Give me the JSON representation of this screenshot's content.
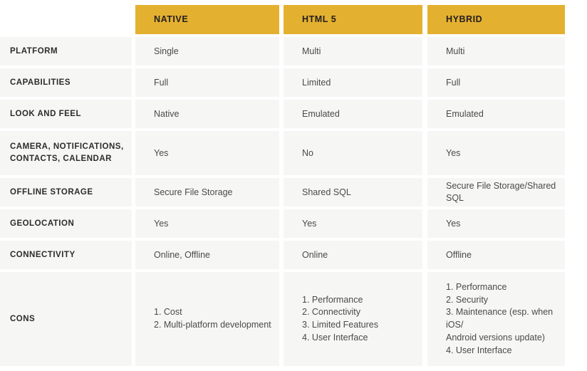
{
  "table": {
    "accent_color": "#e4b030",
    "cell_background": "#f6f6f5",
    "page_background": "#ffffff",
    "label_color": "#2c2c2c",
    "value_color": "#4a4a4a",
    "corner_label": "",
    "columns": [
      "NATIVE",
      "HTML 5",
      "HYBRID"
    ],
    "rows": [
      {
        "label": "PLATFORM",
        "values": [
          "Single",
          "Multi",
          "Multi"
        ]
      },
      {
        "label": "CAPABILITIES",
        "values": [
          "Full",
          "Limited",
          "Full"
        ]
      },
      {
        "label": "LOOK AND FEEL",
        "values": [
          "Native",
          "Emulated",
          "Emulated"
        ]
      },
      {
        "label": "CAMERA, NOTIFICATIONS, CONTACTS, CALENDAR",
        "values": [
          "Yes",
          "No",
          "Yes"
        ]
      },
      {
        "label": "OFFLINE STORAGE",
        "values": [
          "Secure File Storage",
          "Shared SQL",
          "Secure File Storage/Shared SQL"
        ]
      },
      {
        "label": "GEOLOCATION",
        "values": [
          "Yes",
          "Yes",
          "Yes"
        ]
      },
      {
        "label": "CONNECTIVITY",
        "values": [
          "Online, Offline",
          "Online",
          "Offline"
        ]
      },
      {
        "label": "CONS",
        "values": [
          "1. Cost\n2. Multi-platform development",
          "1. Performance\n2. Connectivity\n3. Limited Features\n4. User Interface",
          "1. Performance\n2. Security\n3. Maintenance (esp. when iOS/\nAndroid versions update)\n4. User Interface"
        ]
      }
    ]
  }
}
